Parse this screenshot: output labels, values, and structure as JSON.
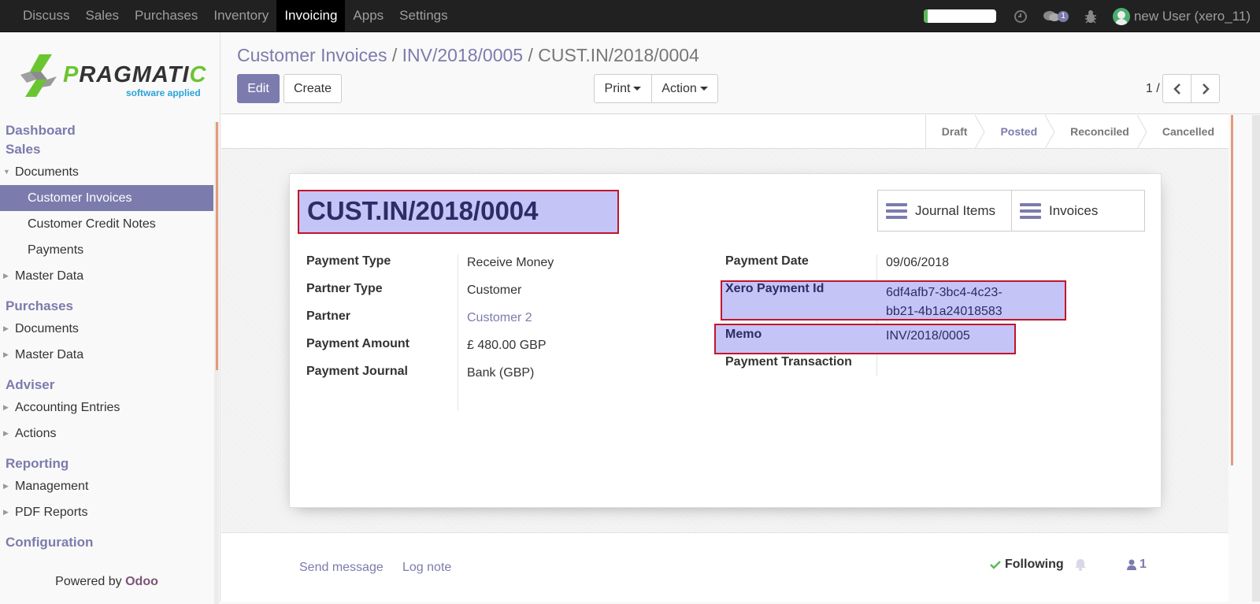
{
  "topbar": {
    "menu": [
      "Discuss",
      "Sales",
      "Purchases",
      "Inventory",
      "Invoicing",
      "Apps",
      "Settings"
    ],
    "active_menu": "Invoicing",
    "progress_fraction": 0.05,
    "messages_badge": "1",
    "user_label": "new User (xero_11)",
    "icons": [
      "clock-icon",
      "chat-icon",
      "bug-icon",
      "avatar-icon"
    ]
  },
  "sidebar": {
    "logo_text": "PRAGMATIC",
    "logo_tagline": "software applied",
    "menu": [
      {
        "type": "header",
        "label": "Dashboard"
      },
      {
        "type": "header",
        "label": "Sales"
      },
      {
        "type": "item",
        "label": "Documents",
        "caret": "expanded"
      },
      {
        "type": "sub",
        "label": "Customer Invoices",
        "active": true
      },
      {
        "type": "sub",
        "label": "Customer Credit Notes"
      },
      {
        "type": "sub",
        "label": "Payments"
      },
      {
        "type": "item",
        "label": "Master Data",
        "caret": "collapsed"
      },
      {
        "type": "header",
        "label": "Purchases"
      },
      {
        "type": "item",
        "label": "Documents",
        "caret": "collapsed"
      },
      {
        "type": "item",
        "label": "Master Data",
        "caret": "collapsed"
      },
      {
        "type": "header",
        "label": "Adviser"
      },
      {
        "type": "item",
        "label": "Accounting Entries",
        "caret": "collapsed"
      },
      {
        "type": "item",
        "label": "Actions",
        "caret": "collapsed"
      },
      {
        "type": "header",
        "label": "Reporting"
      },
      {
        "type": "item",
        "label": "Management",
        "caret": "collapsed"
      },
      {
        "type": "item",
        "label": "PDF Reports",
        "caret": "collapsed"
      },
      {
        "type": "header",
        "label": "Configuration"
      }
    ],
    "powered_by": "Powered by",
    "powered_brand": "Odoo"
  },
  "control_panel": {
    "breadcrumb": [
      "Customer Invoices",
      "INV/2018/0005",
      "CUST.IN/2018/0004"
    ],
    "edit_label": "Edit",
    "create_label": "Create",
    "print_label": "Print",
    "action_label": "Action",
    "pager": "1 / 1"
  },
  "statusbar": {
    "stages": [
      "Draft",
      "Posted",
      "Reconciled",
      "Cancelled"
    ],
    "current": "Posted"
  },
  "form": {
    "title": "CUST.IN/2018/0004",
    "smart_buttons": [
      "Journal Items",
      "Invoices"
    ],
    "left_fields": [
      {
        "label": "Payment Type",
        "value": "Receive Money"
      },
      {
        "label": "Partner Type",
        "value": "Customer"
      },
      {
        "label": "Partner",
        "value": "Customer 2",
        "link": true
      },
      {
        "label": "Payment Amount",
        "value": "£ 480.00 GBP"
      },
      {
        "label": "Payment Journal",
        "value": "Bank (GBP)"
      }
    ],
    "right_fields": [
      {
        "label": "Payment Date",
        "value": "09/06/2018"
      },
      {
        "label": "Xero Payment Id",
        "value_line1": "6df4afb7-3bc4-4c23-",
        "value_line2": "bb21-4b1a24018583"
      },
      {
        "label": "Memo",
        "value": "INV/2018/0005"
      },
      {
        "label": "Payment Transaction",
        "value": ""
      }
    ]
  },
  "chatter": {
    "send_message": "Send message",
    "log_note": "Log note",
    "following": "Following",
    "followers_count": "1"
  },
  "colors": {
    "brand": "#7c7bad",
    "highlight_fill": "#c4c4f7",
    "highlight_border": "#c0162b",
    "topbar": "#212121"
  }
}
